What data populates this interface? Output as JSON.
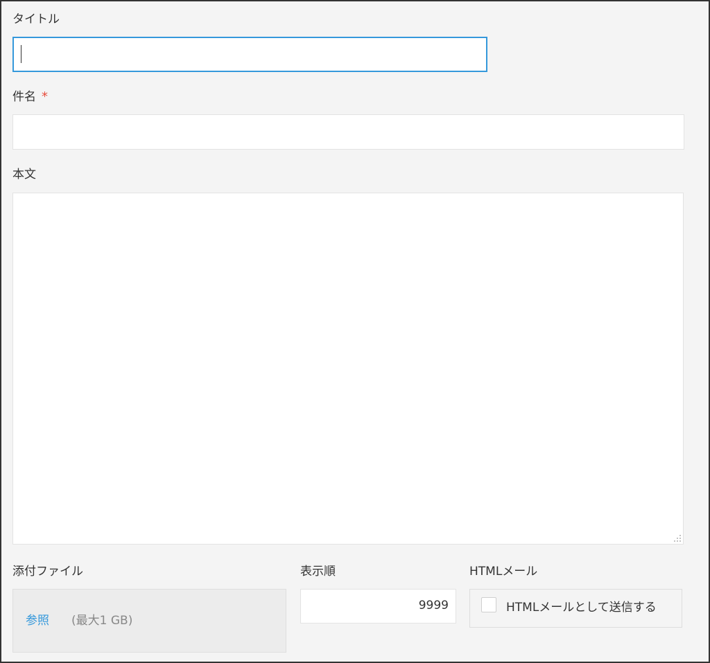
{
  "form": {
    "title_label": "タイトル",
    "title_value": "",
    "subject_label": "件名",
    "required_mark": "*",
    "subject_value": "",
    "body_label": "本文",
    "body_value": "",
    "attachment_label": "添付ファイル",
    "browse_label": "参照",
    "max_size_label": "(最大1 GB)",
    "display_order_label": "表示順",
    "display_order_value": "9999",
    "html_mail_label": "HTMLメール",
    "html_mail_checkbox_label": "HTMLメールとして送信する",
    "html_mail_checked": false
  },
  "colors": {
    "focus_border": "#3498db",
    "required": "#e74c3c",
    "link": "#3498db",
    "background": "#f4f4f4"
  }
}
